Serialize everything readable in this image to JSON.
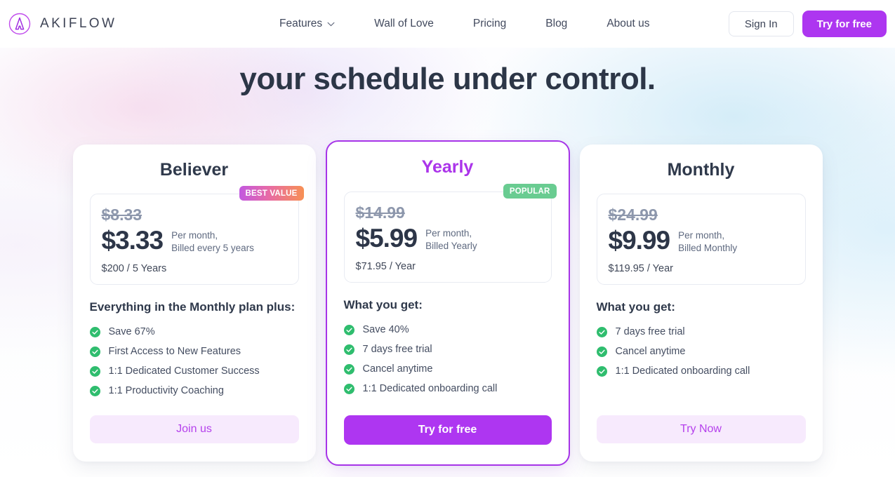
{
  "navbar": {
    "logo_icon": "akiflow-circle-a-logo",
    "brand": "AKIFLOW",
    "brand_color": "#b03ce8",
    "links": [
      {
        "label": "Features",
        "icon": "chevron-down-icon",
        "has_chevron": true
      },
      {
        "label": "Wall of Love",
        "has_chevron": false
      },
      {
        "label": "Pricing",
        "has_chevron": false
      },
      {
        "label": "Blog",
        "has_chevron": false
      },
      {
        "label": "About us",
        "has_chevron": false
      }
    ],
    "sign_in": "Sign In",
    "try_free": "Try for free",
    "accent_color": "#ad36f0"
  },
  "hero": {
    "headline": "your schedule under control."
  },
  "plans": [
    {
      "id": "believer",
      "name": "Believer",
      "featured": false,
      "badge": {
        "text": "BEST VALUE",
        "style": "gradient-pink-orange"
      },
      "price_old": "$8.33",
      "price_now": "$3.33",
      "price_note_line1": "Per month,",
      "price_note_line2": "Billed every 5 years",
      "price_total": "$200 / 5 Years",
      "features_title": "Everything in the Monthly plan plus:",
      "features": [
        "Save 67%",
        "First Access to New Features",
        "1:1 Dedicated Customer Success",
        "1:1 Productivity Coaching"
      ],
      "cta": {
        "label": "Join us",
        "style": "soft"
      }
    },
    {
      "id": "yearly",
      "name": "Yearly",
      "featured": true,
      "badge": {
        "text": "POPULAR",
        "style": "green"
      },
      "price_old": "$14.99",
      "price_now": "$5.99",
      "price_note_line1": "Per month,",
      "price_note_line2": "Billed Yearly",
      "price_total": "$71.95 / Year",
      "features_title": "What you get:",
      "features": [
        "Save 40%",
        "7 days free trial",
        "Cancel anytime",
        "1:1 Dedicated onboarding call"
      ],
      "cta": {
        "label": "Try for free",
        "style": "solid"
      }
    },
    {
      "id": "monthly",
      "name": "Monthly",
      "featured": false,
      "badge": null,
      "price_old": "$24.99",
      "price_now": "$9.99",
      "price_note_line1": "Per month,",
      "price_note_line2": "Billed Monthly",
      "price_total": "$119.95 / Year",
      "features_title": "What you get:",
      "features": [
        "7 days free trial",
        "Cancel anytime",
        "1:1 Dedicated onboarding call"
      ],
      "cta": {
        "label": "Try Now",
        "style": "soft"
      }
    }
  ],
  "icons": {
    "check": "check-circle-icon",
    "check_color": "#2fbd6e"
  }
}
